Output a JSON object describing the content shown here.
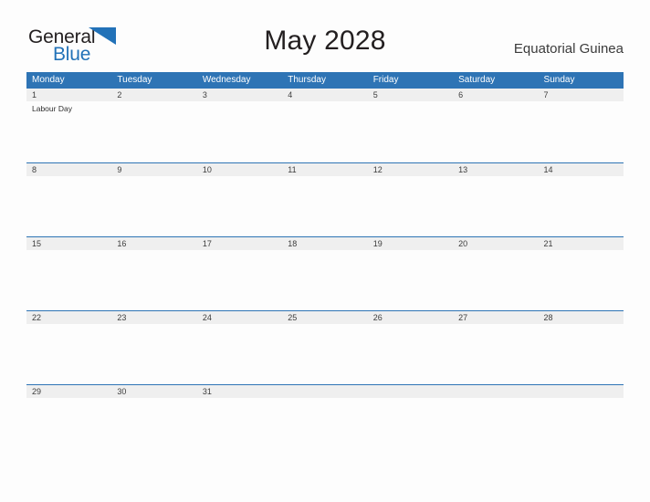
{
  "brand": {
    "line1": "General",
    "line2": "Blue",
    "flag_icon": "flag-triangle-icon",
    "dark_color": "#231f20",
    "blue_color": "#2272b8"
  },
  "header": {
    "title": "May 2028",
    "country": "Equatorial Guinea"
  },
  "theme": {
    "header_bar": "#2e74b5",
    "date_strip": "#efefef",
    "page_background": "#fdfdfd",
    "text": "#3c3c3c"
  },
  "calendar": {
    "weekdays": [
      "Monday",
      "Tuesday",
      "Wednesday",
      "Thursday",
      "Friday",
      "Saturday",
      "Sunday"
    ],
    "weeks": [
      {
        "days": [
          {
            "num": "1",
            "events": [
              "Labour Day"
            ]
          },
          {
            "num": "2",
            "events": []
          },
          {
            "num": "3",
            "events": []
          },
          {
            "num": "4",
            "events": []
          },
          {
            "num": "5",
            "events": []
          },
          {
            "num": "6",
            "events": []
          },
          {
            "num": "7",
            "events": []
          }
        ]
      },
      {
        "days": [
          {
            "num": "8",
            "events": []
          },
          {
            "num": "9",
            "events": []
          },
          {
            "num": "10",
            "events": []
          },
          {
            "num": "11",
            "events": []
          },
          {
            "num": "12",
            "events": []
          },
          {
            "num": "13",
            "events": []
          },
          {
            "num": "14",
            "events": []
          }
        ]
      },
      {
        "days": [
          {
            "num": "15",
            "events": []
          },
          {
            "num": "16",
            "events": []
          },
          {
            "num": "17",
            "events": []
          },
          {
            "num": "18",
            "events": []
          },
          {
            "num": "19",
            "events": []
          },
          {
            "num": "20",
            "events": []
          },
          {
            "num": "21",
            "events": []
          }
        ]
      },
      {
        "days": [
          {
            "num": "22",
            "events": []
          },
          {
            "num": "23",
            "events": []
          },
          {
            "num": "24",
            "events": []
          },
          {
            "num": "25",
            "events": []
          },
          {
            "num": "26",
            "events": []
          },
          {
            "num": "27",
            "events": []
          },
          {
            "num": "28",
            "events": []
          }
        ]
      },
      {
        "days": [
          {
            "num": "29",
            "events": []
          },
          {
            "num": "30",
            "events": []
          },
          {
            "num": "31",
            "events": []
          },
          {
            "num": "",
            "events": []
          },
          {
            "num": "",
            "events": []
          },
          {
            "num": "",
            "events": []
          },
          {
            "num": "",
            "events": []
          }
        ]
      }
    ]
  }
}
